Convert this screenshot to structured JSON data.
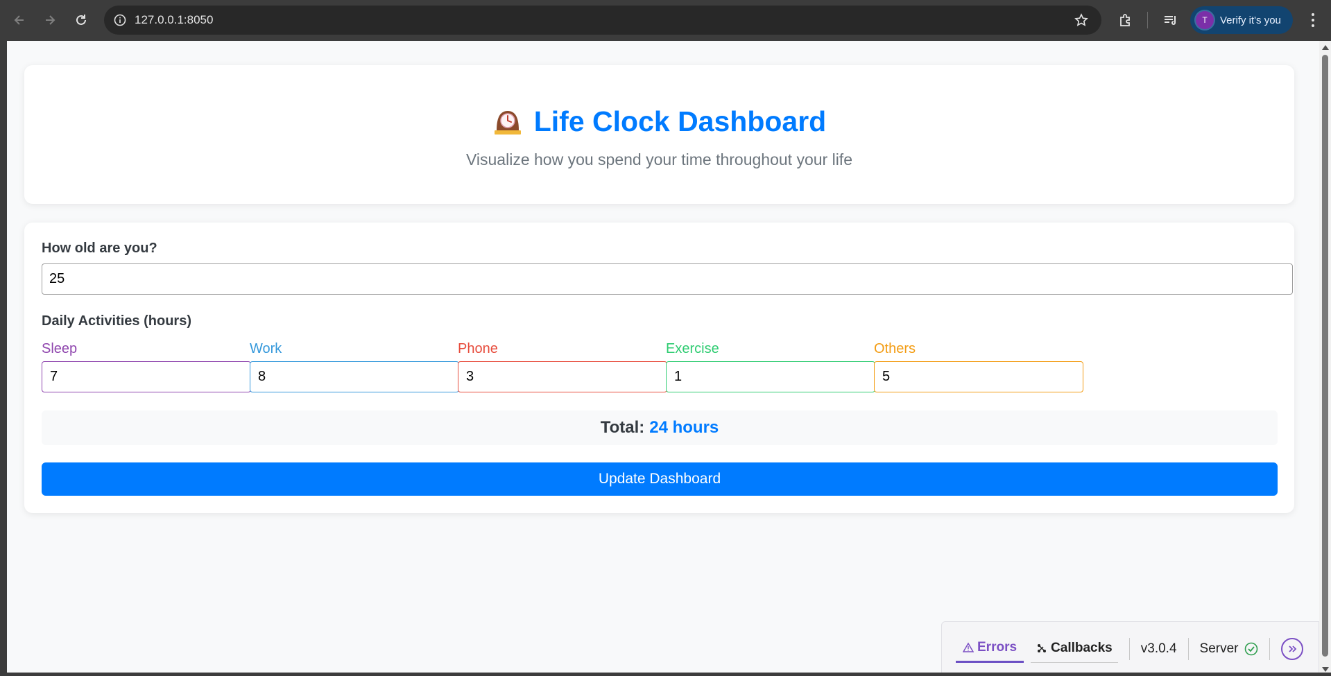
{
  "browser": {
    "url": "127.0.0.1:8050",
    "verify_label": "Verify it's you",
    "avatar_letter": "T"
  },
  "header": {
    "title": "Life Clock Dashboard",
    "title_icon": "mantelpiece-clock-icon",
    "subtitle": "Visualize how you spend your time throughout your life"
  },
  "form": {
    "age_label": "How old are you?",
    "age_value": "25",
    "activities_label": "Daily Activities (hours)",
    "activities": [
      {
        "label": "Sleep",
        "value": "7",
        "color": "#8e44ad"
      },
      {
        "label": "Work",
        "value": "8",
        "color": "#3498db"
      },
      {
        "label": "Phone",
        "value": "3",
        "color": "#e74c3c"
      },
      {
        "label": "Exercise",
        "value": "1",
        "color": "#2ecc71"
      },
      {
        "label": "Others",
        "value": "5",
        "color": "#f39c12"
      }
    ],
    "total_label": "Total:",
    "total_value": "24 hours",
    "update_button": "Update Dashboard"
  },
  "devtools": {
    "errors_label": "Errors",
    "callbacks_label": "Callbacks",
    "version": "v3.0.4",
    "server_label": "Server"
  },
  "colors": {
    "accent": "#007bff",
    "devtools_accent": "#7b4fc4"
  }
}
